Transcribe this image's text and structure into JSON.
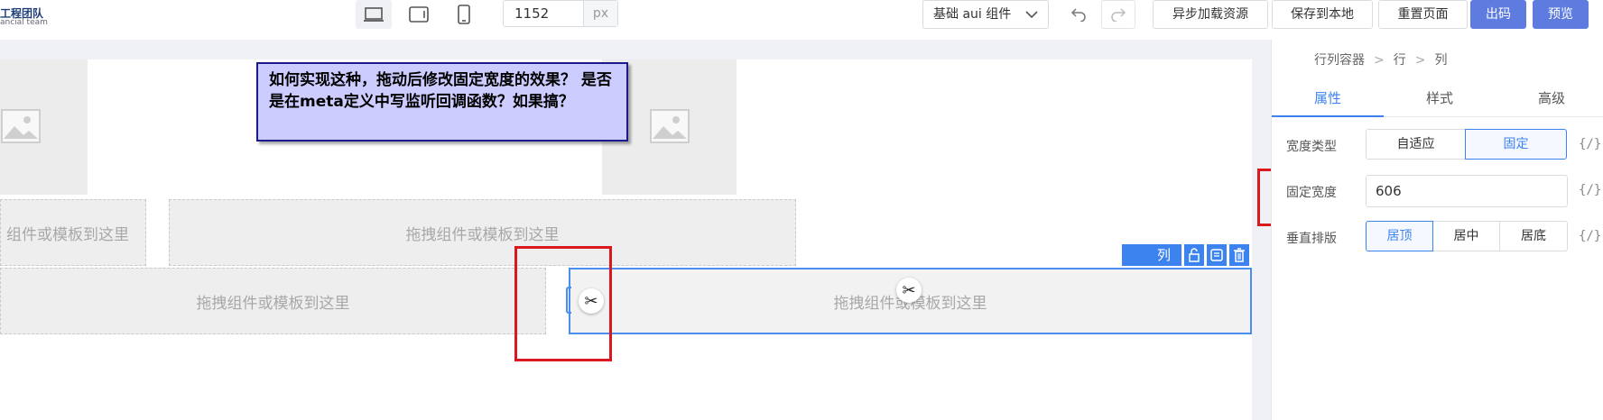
{
  "header": {
    "logo_cn": "工程团队",
    "logo_en": "ancial team",
    "width_value": "1152",
    "width_unit": "px",
    "component_select": "基础 aui 组件",
    "buttons": {
      "async_load": "异步加载资源",
      "save_local": "保存到本地",
      "reset": "重置页面",
      "export_code": "出码",
      "preview": "预览"
    }
  },
  "canvas": {
    "drop_hint": "拖拽组件或模板到这里",
    "drop_hint_cut": "组件或模板到这里",
    "selected_label": "列",
    "annotation": "如何实现这种，拖动后修改固定宽度的效果？ 是否是在meta定义中写监听回调函数？如果搞？"
  },
  "panel": {
    "breadcrumb": [
      "行列容器",
      "行",
      "列"
    ],
    "tabs": [
      "属性",
      "样式",
      "高级"
    ],
    "width_type_label": "宽度类型",
    "width_type_options": [
      "自适应",
      "固定"
    ],
    "width_type_selected": "固定",
    "fixed_width_label": "固定宽度",
    "fixed_width_value": "606",
    "vertical_label": "垂直排版",
    "vertical_options": [
      "居顶",
      "居中",
      "居底"
    ],
    "vertical_selected": "居顶",
    "expr_symbol": "{/}"
  },
  "colors": {
    "primary": "#5e7ce0",
    "accent": "#3d83f0",
    "highlight": "#d9181f",
    "note_bg": "#ccccff"
  }
}
